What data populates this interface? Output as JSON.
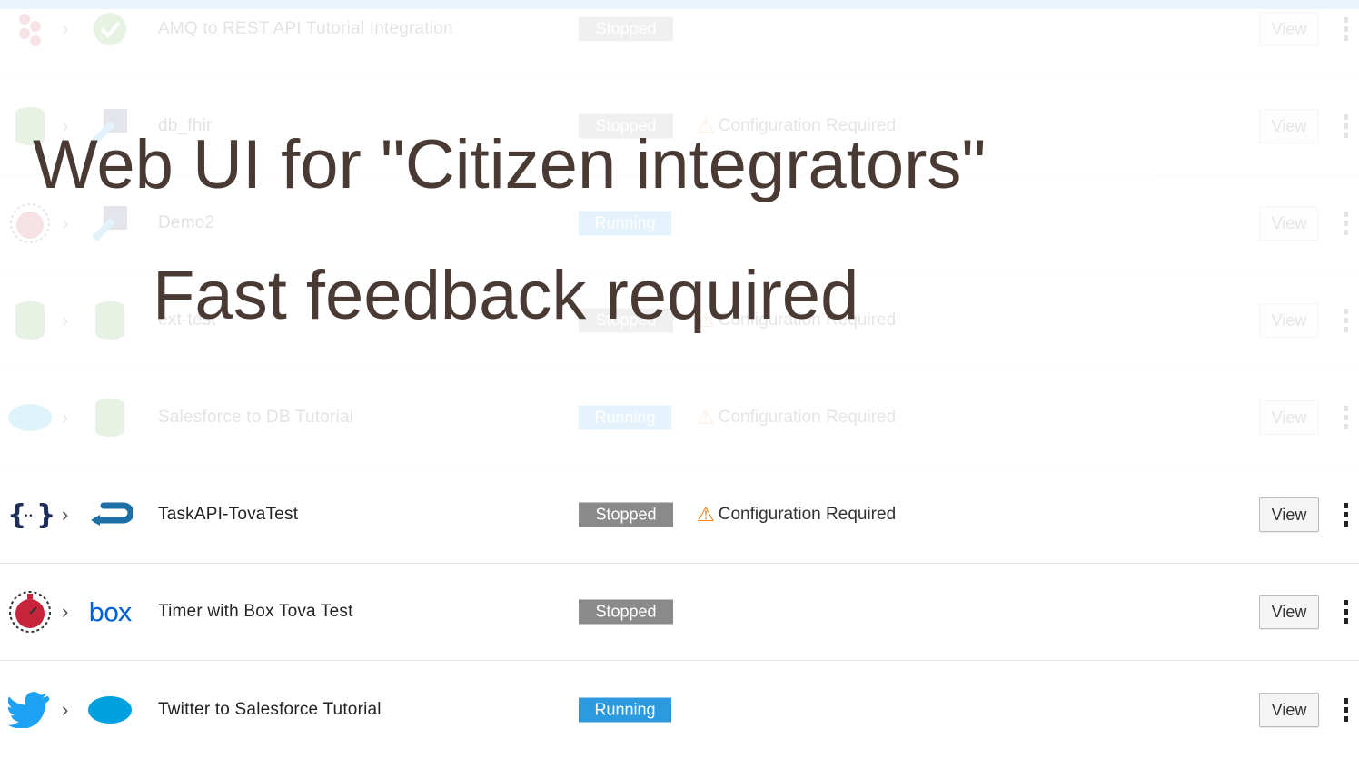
{
  "overlay": {
    "title": "Web UI for \"Citizen integrators\"",
    "subtitle": "Fast feedback required"
  },
  "integrations": [
    {
      "name": "AMQ to REST API Tutorial Integration",
      "status": "Stopped",
      "warning": "",
      "view_label": "View",
      "start_icon": "amq-icon",
      "end_icon": "check-circle-icon"
    },
    {
      "name": "db_fhir",
      "status": "Stopped",
      "warning": "Configuration Required",
      "view_label": "View",
      "start_icon": "database-icon",
      "end_icon": "fhir-icon"
    },
    {
      "name": "Demo2",
      "status": "Running",
      "warning": "",
      "view_label": "View",
      "start_icon": "timer-icon",
      "end_icon": "fhir-icon"
    },
    {
      "name": "ext-test",
      "status": "Stopped",
      "warning": "Configuration Required",
      "view_label": "View",
      "start_icon": "database-icon",
      "end_icon": "database-icon"
    },
    {
      "name": "Salesforce to DB Tutorial",
      "status": "Running",
      "warning": "Configuration Required",
      "view_label": "View",
      "start_icon": "salesforce-icon",
      "end_icon": "database-icon"
    },
    {
      "name": "TaskAPI-TovaTest",
      "status": "Stopped",
      "warning": "Configuration Required",
      "view_label": "View",
      "start_icon": "api-icon",
      "end_icon": "api-connector-icon"
    },
    {
      "name": "Timer with Box Tova Test",
      "status": "Stopped",
      "warning": "",
      "view_label": "View",
      "start_icon": "timer-icon",
      "end_icon": "box-icon",
      "end_icon_text": "box"
    },
    {
      "name": "Twitter to Salesforce Tutorial",
      "status": "Running",
      "warning": "",
      "view_label": "View",
      "start_icon": "twitter-icon",
      "end_icon": "salesforce-icon"
    }
  ],
  "colors": {
    "stopped": "#8a8a8a",
    "running": "#2c9adf",
    "warning": "#ec7a08",
    "overlay_text": "#4a3a34"
  }
}
